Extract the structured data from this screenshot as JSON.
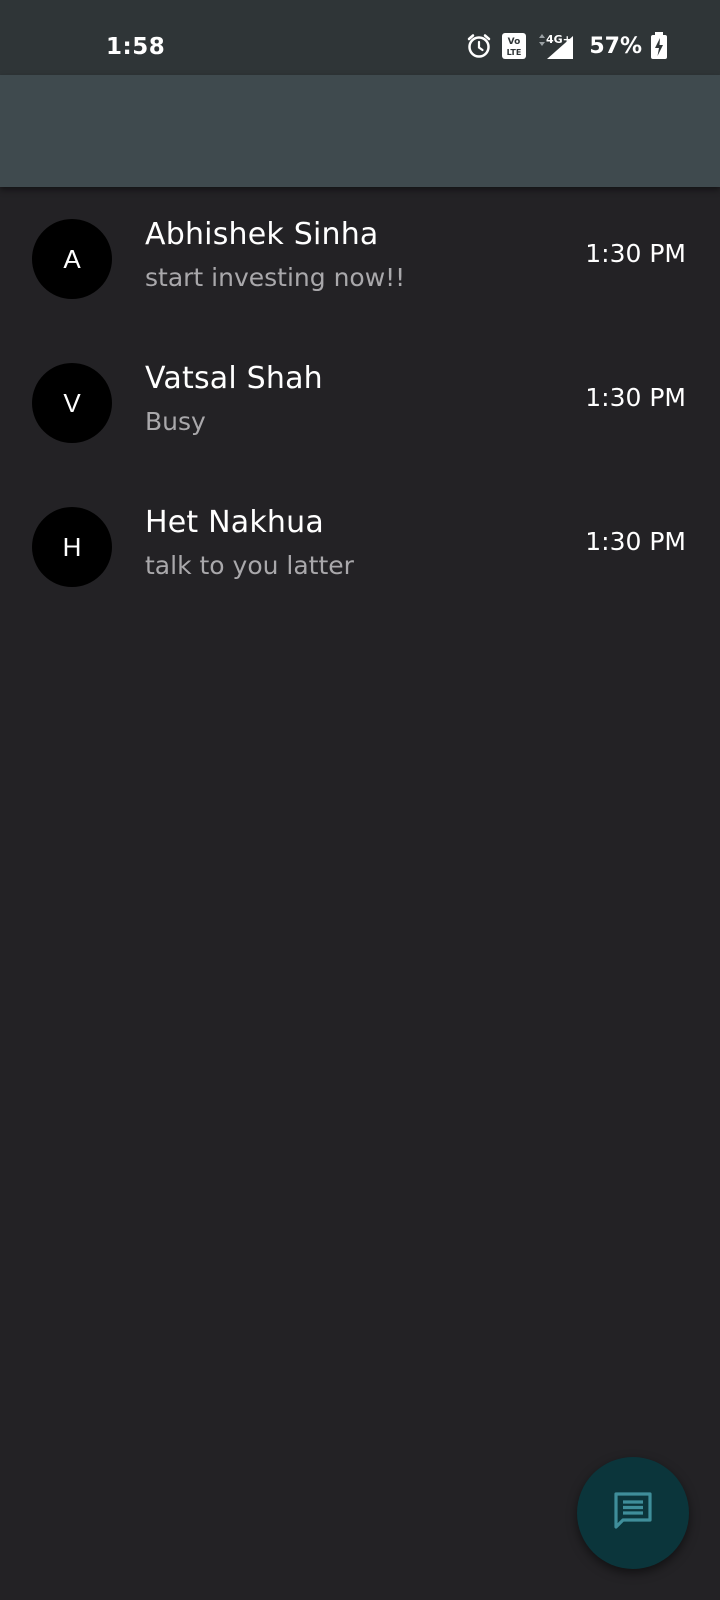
{
  "status_bar": {
    "time": "1:58",
    "battery_percent": "57%",
    "icons": [
      "alarm-icon",
      "volte-icon",
      "4g-icon",
      "signal-icon",
      "battery-charging-icon"
    ],
    "network_label": "4G+",
    "volte_label": "Vo LTE"
  },
  "chats": [
    {
      "initial": "A",
      "name": "Abhishek Sinha",
      "message": "start investing now!!",
      "time": "1:30 PM"
    },
    {
      "initial": "V",
      "name": "Vatsal Shah",
      "message": "Busy",
      "time": "1:30 PM"
    },
    {
      "initial": "H",
      "name": "Het Nakhua",
      "message": "talk to you latter",
      "time": "1:30 PM"
    }
  ],
  "fab": {
    "icon": "message-icon"
  },
  "colors": {
    "background": "#232225",
    "status_bar": "#2f3537",
    "app_bar": "#3f4a4e",
    "avatar": "#000000",
    "fab": "#0b353b",
    "fab_icon": "#3f8e9a",
    "secondary_text": "#a9a8ab"
  }
}
